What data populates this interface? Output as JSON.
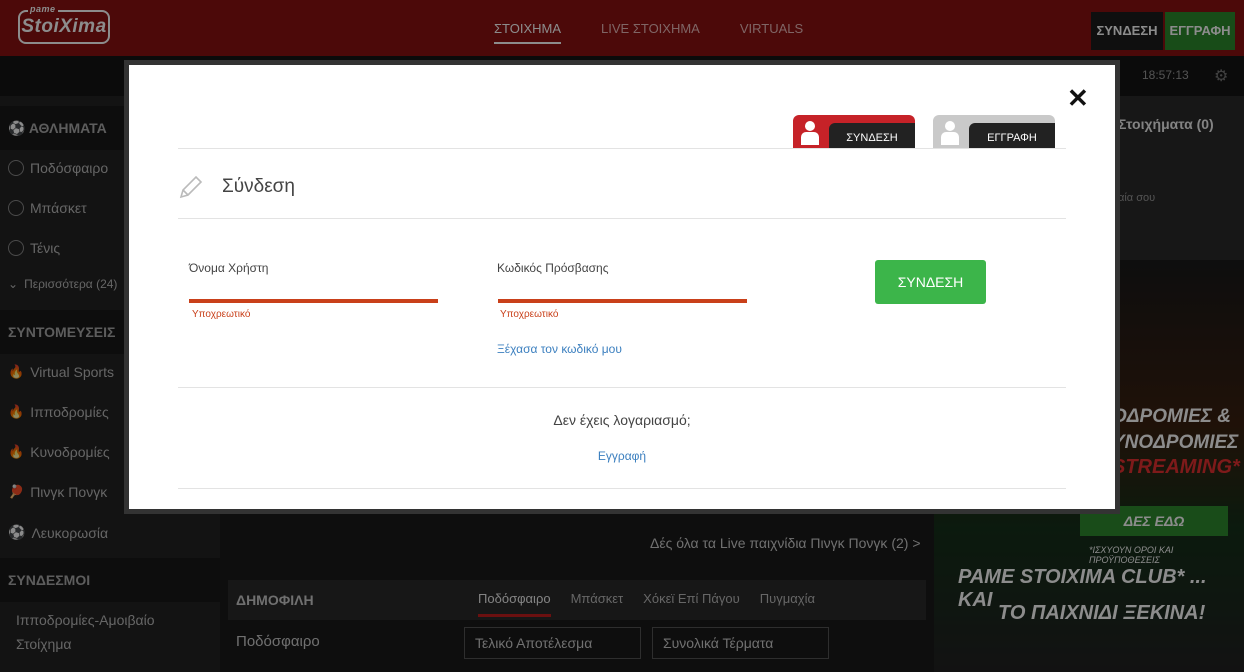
{
  "header": {
    "logo_small": "pame",
    "logo": "StoiXima",
    "nav": [
      "ΣΤΟΙΧΗΜΑ",
      "LIVE ΣΤΟΙΧΗΜΑ",
      "VIRTUALS"
    ],
    "login_label": "ΣΥΝΔΕΣΗ",
    "register_label": "ΕΓΓΡΑΦΗ",
    "time": "18:57:13"
  },
  "sidebar": {
    "sports_title": "ΑΘΛΗΜΑΤΑ",
    "sports": [
      "Ποδόσφαιρο",
      "Μπάσκετ",
      "Τένις"
    ],
    "more": "Περισσότερα (24)",
    "shortcuts_title": "ΣΥΝΤΟΜΕΥΣΕΙΣ",
    "shortcuts": [
      "Virtual Sports",
      "Ιπποδρομίες",
      "Κυνοδρομίες",
      "Πινγκ Πονγκ",
      "Λευκορωσία"
    ],
    "links_title": "ΣΥΝΔΕΣΜΟΙ",
    "links": [
      "Ιπποδρομίες-Αμοιβαίο",
      "Στοίχημα"
    ]
  },
  "betslip": {
    "title": "Στοιχήματα (0)",
    "subtitle": "αία σου"
  },
  "promo": {
    "line1": "ΟΔΡΟΜΙΕΣ &",
    "line2": "ΥΝΟΔΡΟΜΙΕΣ",
    "line3": "STREAMING*",
    "button": "ΔΕΣ ΕΔΩ",
    "terms": "*ΙΣΧΥΟΥΝ ΟΡΟΙ ΚΑΙ ΠΡΟΫΠΟΘΕΣΕΙΣ",
    "club1": "PAME STOIXIMA CLUB* ... ΚΑΙ",
    "club2": "ΤΟ ΠΑΙΧΝΙΔΙ ΞΕΚΙΝΑ!"
  },
  "main": {
    "live_link": "Δές όλα τα Live παιχνίδια Πινγκ Πονγκ (2) >",
    "popular_title": "ΔΗΜΟΦΙΛΗ",
    "popular_tabs": [
      "Ποδόσφαιρο",
      "Μπάσκετ",
      "Χόκεϊ Επί Πάγου",
      "Πυγμαχία"
    ],
    "sport_label": "Ποδόσφαιρο",
    "select1": "Τελικό Αποτέλεσμα",
    "select2": "Συνολικά Τέρματα"
  },
  "modal": {
    "tab_login": "ΣΥΝΔΕΣΗ",
    "tab_register": "ΕΓΓΡΑΦΗ",
    "title": "Σύνδεση",
    "username_label": "Όνομα Χρήστη",
    "username_value": "",
    "password_label": "Κωδικός Πρόσβασης",
    "password_value": "",
    "required": "Υποχρεωτικό",
    "forgot": "Ξέχασα τον κωδικό μου",
    "submit": "ΣΥΝΔΕΣΗ",
    "no_account": "Δεν έχεις λογαριασμό;",
    "register": "Εγγραφή"
  },
  "colors": {
    "brand_red": "#8a1212",
    "accent_green": "#3cb54a",
    "error_orange": "#c9401a",
    "link_blue": "#3b7fbf"
  }
}
